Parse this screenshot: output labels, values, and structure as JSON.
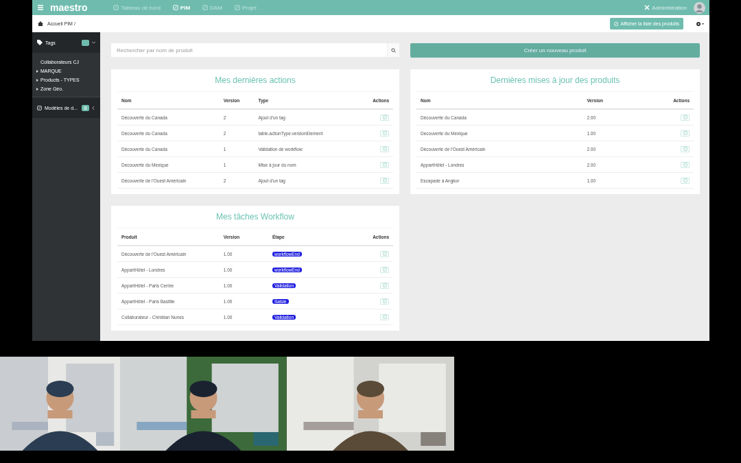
{
  "topbar": {
    "logo": "maestro",
    "nav": [
      {
        "label": "Tableau de bord",
        "selected": false
      },
      {
        "label": "PIM",
        "selected": true
      },
      {
        "label": "DAM",
        "selected": false
      },
      {
        "label": "Projet",
        "selected": false
      }
    ],
    "admin": "Administration"
  },
  "breadcrumb": "Accueil PIM /",
  "list_button": "Afficher la liste des produits",
  "sidebar": {
    "tags": {
      "label": "Tags",
      "expanded": true
    },
    "items": [
      {
        "label": "Collaborateurs CJ",
        "has_children": false
      },
      {
        "label": "MARQUE",
        "has_children": true
      },
      {
        "label": "Products - TYPES",
        "has_children": true
      },
      {
        "label": "Zone Géo.",
        "has_children": true
      }
    ],
    "models": {
      "label": "Modèles de d...",
      "count": "8"
    }
  },
  "search": {
    "placeholder": "Rechercher par nom de produit"
  },
  "create_button": "Créer un nouveau produit",
  "panels": [
    {
      "title": "Mes dernières actions",
      "columns": [
        "Nom",
        "Version",
        "Type",
        "Actions"
      ],
      "rows": [
        [
          "Découverte du Canada",
          "2",
          "Ajout d'un tag"
        ],
        [
          "Découverte du Canada",
          "2",
          "table.actionType.versionElement"
        ],
        [
          "Découverte du Canada",
          "1",
          "Validation de workflow"
        ],
        [
          "Decouverte du Mexique",
          "1",
          "Mise à jour du nom"
        ],
        [
          "Découverte de l'Ouest Américain",
          "2",
          "Ajout d'un tag"
        ]
      ]
    },
    {
      "title": "Dernières mises à jour des produits",
      "columns": [
        "Nom",
        "Version",
        "Actions"
      ],
      "rows": [
        [
          "Découverte du Canada",
          "2.00"
        ],
        [
          "Decouverte du Mexique",
          "1.00"
        ],
        [
          "Découverte de l'Ouest Américain",
          "2.00"
        ],
        [
          "AppartHôtel - Londres",
          "2.00"
        ],
        [
          "Escapade à Angkor",
          "1.00"
        ]
      ]
    },
    {
      "title": "Mes tâches Workflow",
      "columns": [
        "Produit",
        "Version",
        "Étape",
        "Actions"
      ],
      "rows": [
        [
          "Découverte de l'Ouest Américain",
          "1.00",
          "workflowEnd"
        ],
        [
          "AppartHôtel - Londres",
          "1.00",
          "workflowEnd"
        ],
        [
          "AppartHôtel - Paris Centre",
          "1.00",
          "Validation"
        ],
        [
          "AppartHôtel - Paris Bastille",
          "1.00",
          "Saisie"
        ],
        [
          "Collaborateur - Christian Nunes",
          "1.00",
          "Validation"
        ]
      ]
    }
  ]
}
